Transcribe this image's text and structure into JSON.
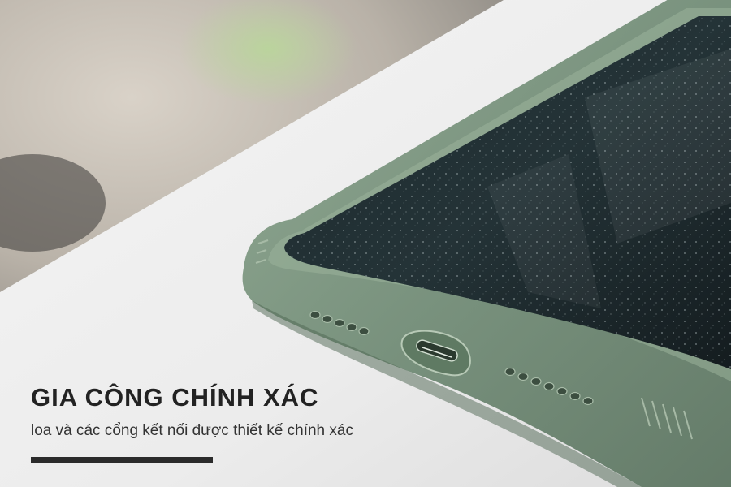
{
  "headline": "GIA CÔNG CHÍNH XÁC",
  "subline": "loa và các cổng kết nối được thiết kế chính xác",
  "colors": {
    "case_green": "#6f8a74",
    "text": "#222222",
    "rule": "#2b2b2b",
    "surface": "#ececec"
  },
  "icons": {
    "phone": "phone-photo",
    "speaker": "speaker-grille-icon",
    "port": "charging-port-icon"
  }
}
